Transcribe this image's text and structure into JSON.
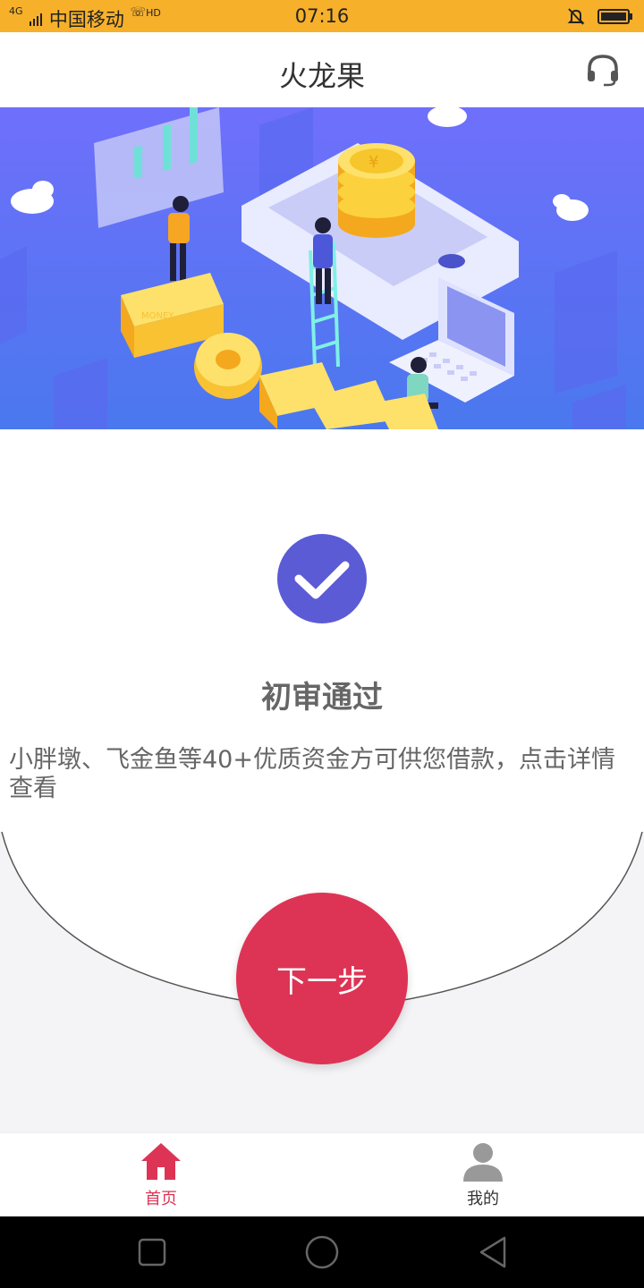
{
  "status_bar": {
    "carrier": "中国移动",
    "network": "4G",
    "call": "HD",
    "time": "07:16"
  },
  "header": {
    "title": "火龙果",
    "support_icon": "headset-icon"
  },
  "banner": {
    "text": "MONEY",
    "icons": [
      "coin-stack-icon",
      "phone-illustration",
      "laptop-illustration"
    ]
  },
  "result": {
    "icon": "check-icon",
    "title": "初审通过",
    "description": "小胖墩、飞金鱼等40+优质资金方可供您借款，点击详情查看"
  },
  "next_button": {
    "label": "下一步"
  },
  "tabs": [
    {
      "label": "首页",
      "icon": "home-icon",
      "active": true
    },
    {
      "label": "我的",
      "icon": "user-icon",
      "active": false
    }
  ],
  "colors": {
    "status_bar": "#f7b02a",
    "check_circle": "#5b5bd6",
    "button": "#dd3455",
    "tab_active": "#dd3455",
    "tab_inactive": "#999999"
  }
}
